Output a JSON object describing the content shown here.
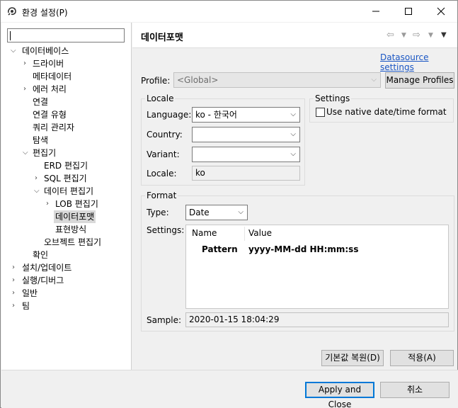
{
  "window": {
    "title": "환경 설정(P)",
    "controls": [
      "minimize-icon",
      "maximize-icon",
      "close-icon"
    ]
  },
  "left": {
    "filter_value": "",
    "tree": [
      {
        "label": "데이터베이스",
        "expanded": true
      },
      {
        "label": "드라이버",
        "collapsed": true
      },
      {
        "label": "메타데이터"
      },
      {
        "label": "에러 처리",
        "collapsed": true
      },
      {
        "label": "연결"
      },
      {
        "label": "연결 유형"
      },
      {
        "label": "쿼리 관리자"
      },
      {
        "label": "탐색"
      },
      {
        "label": "편집기",
        "expanded": true
      },
      {
        "label": "ERD 편집기"
      },
      {
        "label": "SQL 편집기",
        "collapsed": true
      },
      {
        "label": "데이터 편집기",
        "expanded": true
      },
      {
        "label": "LOB 편집기",
        "collapsed": true
      },
      {
        "label": "데이터포맷",
        "selected": true
      },
      {
        "label": "표현방식"
      },
      {
        "label": "오브젝트 편집기"
      },
      {
        "label": "확인"
      },
      {
        "label": "설치/업데이트",
        "collapsed": true
      },
      {
        "label": "실행/디버그",
        "collapsed": true
      },
      {
        "label": "일반",
        "collapsed": true
      },
      {
        "label": "팀",
        "collapsed": true
      }
    ]
  },
  "right": {
    "page_title": "데이터포맷",
    "nav_icons": [
      "back-arrow-icon",
      "back-menu-icon",
      "forward-arrow-icon",
      "forward-menu-icon",
      "view-menu-icon"
    ],
    "datasource_link": "Datasource settings",
    "profile": {
      "label": "Profile:",
      "value": "<Global>",
      "manage_button": "Manage Profiles"
    },
    "locale": {
      "group_label": "Locale",
      "language_label": "Language:",
      "language_value": "ko - 한국어",
      "country_label": "Country:",
      "country_value": "",
      "variant_label": "Variant:",
      "variant_value": "",
      "locale_label": "Locale:",
      "locale_value": "ko"
    },
    "settings": {
      "group_label": "Settings",
      "native_checkbox_label": "Use native date/time format",
      "native_checked": false
    },
    "format": {
      "group_label": "Format",
      "type_label": "Type:",
      "type_value": "Date",
      "settings_label": "Settings:",
      "columns": [
        "Name",
        "Value"
      ],
      "rows": [
        {
          "name": "Pattern",
          "value": "yyyy-MM-dd HH:mm:ss"
        }
      ],
      "sample_label": "Sample:",
      "sample_value": "2020-01-15 18:04:29"
    },
    "restore_defaults_button": "기본값 복원(D)",
    "apply_button": "적용(A)"
  },
  "bottom": {
    "apply_close_button": "Apply and Close",
    "cancel_button": "취소"
  },
  "colors": {
    "link": "#1a56c4",
    "default_button_border": "#0078d7",
    "selection": "#d9d9d9"
  }
}
